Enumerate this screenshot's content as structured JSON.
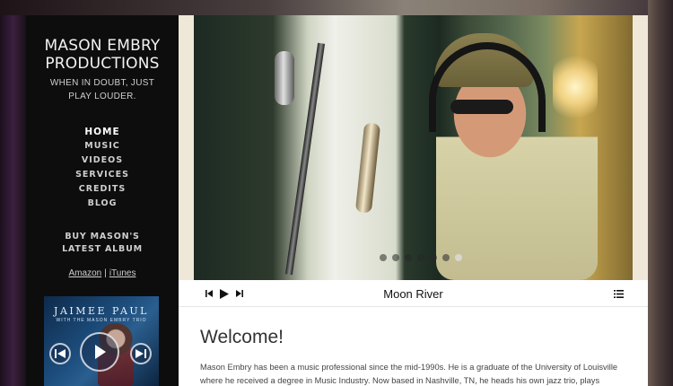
{
  "site": {
    "title": "MASON EMBRY PRODUCTIONS",
    "tagline": "WHEN IN DOUBT, JUST PLAY LOUDER."
  },
  "nav": {
    "items": [
      {
        "label": "HOME",
        "active": true
      },
      {
        "label": "MUSIC",
        "active": false
      },
      {
        "label": "VIDEOS",
        "active": false
      },
      {
        "label": "SERVICES",
        "active": false
      },
      {
        "label": "CREDITS",
        "active": false
      },
      {
        "label": "BLOG",
        "active": false
      }
    ]
  },
  "buy": {
    "heading": "BUY MASON'S LATEST ALBUM",
    "links": [
      "Amazon",
      "iTunes"
    ],
    "separator": "|"
  },
  "album": {
    "title": "JAIMEE PAUL",
    "subtitle": "WITH THE MASON EMBRY TRIO",
    "controls": [
      "previous-icon",
      "play-icon",
      "next-icon"
    ]
  },
  "slideshow": {
    "slide_count": 7,
    "active_index": 6
  },
  "player": {
    "track_title": "Moon River",
    "icons": [
      "previous-track-icon",
      "play-icon",
      "next-track-icon",
      "playlist-icon"
    ]
  },
  "main": {
    "heading": "Welcome!",
    "intro": "Mason Embry has been a music professional since the mid-1990s. He is a graduate of the University of Louisville where he received a degree in Music Industry. Now based in Nashville, TN, he heads his own jazz trio, plays keyboards for country"
  },
  "colors": {
    "sidebar_bg": "#0d0d0d",
    "main_bg": "#ffffff",
    "heading_text": "#333333"
  }
}
